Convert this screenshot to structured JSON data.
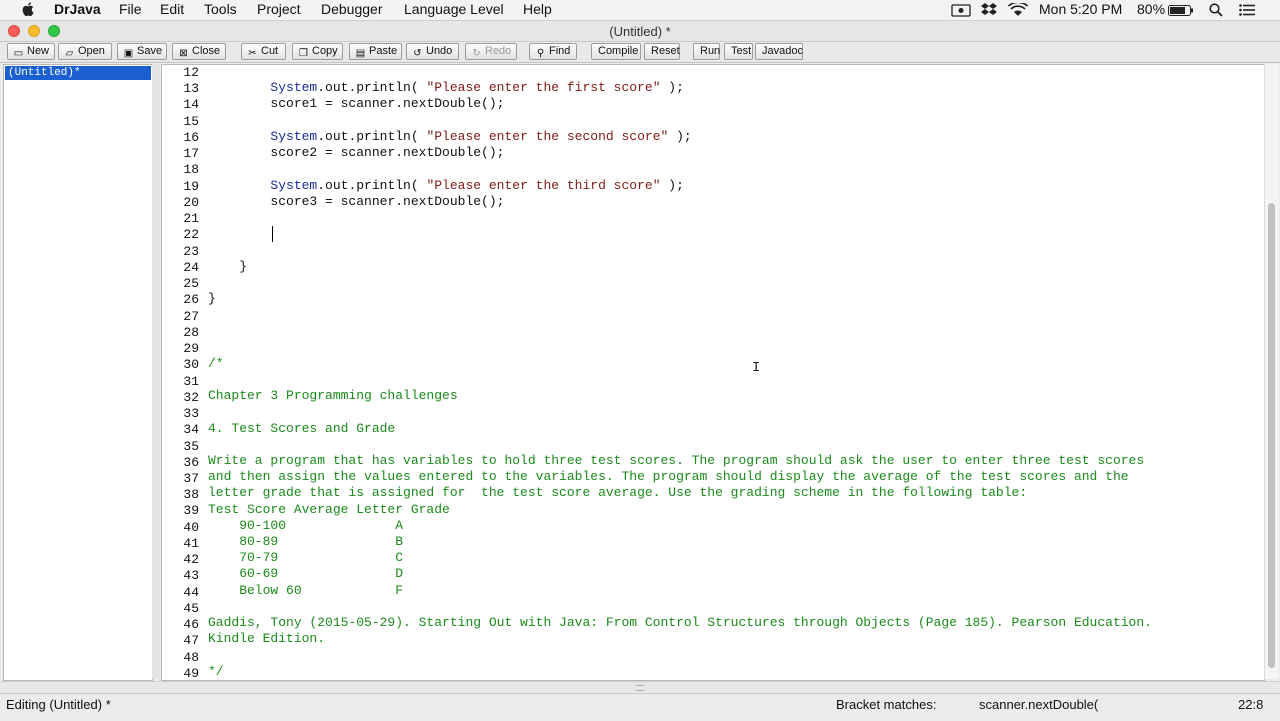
{
  "menubar": {
    "app": "DrJava",
    "items": [
      "File",
      "Edit",
      "Tools",
      "Project",
      "Debugger",
      "Language Level",
      "Help"
    ],
    "clock": "Mon 5:20 PM",
    "battery": "80%"
  },
  "window": {
    "title": "(Untitled) *"
  },
  "toolbar": {
    "new": "New",
    "open": "Open",
    "save": "Save",
    "close": "Close",
    "cut": "Cut",
    "copy": "Copy",
    "paste": "Paste",
    "undo": "Undo",
    "redo": "Redo",
    "find": "Find",
    "compile": "Compile",
    "reset": "Reset",
    "run": "Run",
    "test": "Test",
    "javadoc": "Javadoc"
  },
  "files": {
    "selected": "(Untitled)*"
  },
  "editor": {
    "line_numbers": [
      "12",
      "13",
      "14",
      "15",
      "16",
      "17",
      "18",
      "19",
      "20",
      "21",
      "22",
      "23",
      "24",
      "25",
      "26",
      "27",
      "28",
      "29",
      "30",
      "31",
      "32",
      "33",
      "34",
      "35",
      "36",
      "37",
      "38",
      "39",
      "40",
      "41",
      "42",
      "43",
      "44",
      "45",
      "46",
      "47",
      "48",
      "49"
    ],
    "lines": {
      "l13_sys": "System",
      "l13_rest": ".out.println( ",
      "l13_str": "\"Please enter the first score\"",
      "l13_end": " );",
      "l14": "score1 = scanner.nextDouble();",
      "l16_sys": "System",
      "l16_rest": ".out.println( ",
      "l16_str": "\"Please enter the second score\"",
      "l16_end": " );",
      "l17": "score2 = scanner.nextDouble();",
      "l19_sys": "System",
      "l19_rest": ".out.println( ",
      "l19_str": "\"Please enter the third score\"",
      "l19_end": " );",
      "l20": "score3 = scanner.nextDouble();",
      "l24": "}",
      "l26": "}",
      "l30": "/*",
      "l32": "Chapter 3 Programming challenges",
      "l34": "4. Test Scores and Grade",
      "l36": "Write a program that has variables to hold three test scores. The program should ask the user to enter three test scores",
      "l37": "and then assign the values entered to the variables. The program should display the average of the test scores and the",
      "l38": "letter grade that is assigned for  the test score average. Use the grading scheme in the following table:",
      "l39": "Test Score Average Letter Grade",
      "l40": "    90-100              A",
      "l41": "    80-89               B",
      "l42": "    70-79               C",
      "l43": "    60-69               D",
      "l44": "    Below 60            F",
      "l46": "Gaddis, Tony (2015-05-29). Starting Out with Java: From Control Structures through Objects (Page 185). Pearson Education.",
      "l47": "Kindle Edition.",
      "l49": "*/"
    }
  },
  "status": {
    "left": "Editing (Untitled) *",
    "bracket_label": "Bracket matches:",
    "bracket_value": "scanner.nextDouble(",
    "position": "22:8"
  },
  "scroll": {
    "thumb_start_fraction": 0.226,
    "thumb_length_fraction": 0.756
  },
  "colors": {
    "string": "#7e1b17",
    "system": "#1a2b9b",
    "comment": "#1b8a1b",
    "selection": "#1c5fd1"
  },
  "icons": [
    "apple-icon",
    "wifi-icon",
    "search-icon",
    "list-icon",
    "dropbox-icon",
    "screen-icon"
  ]
}
